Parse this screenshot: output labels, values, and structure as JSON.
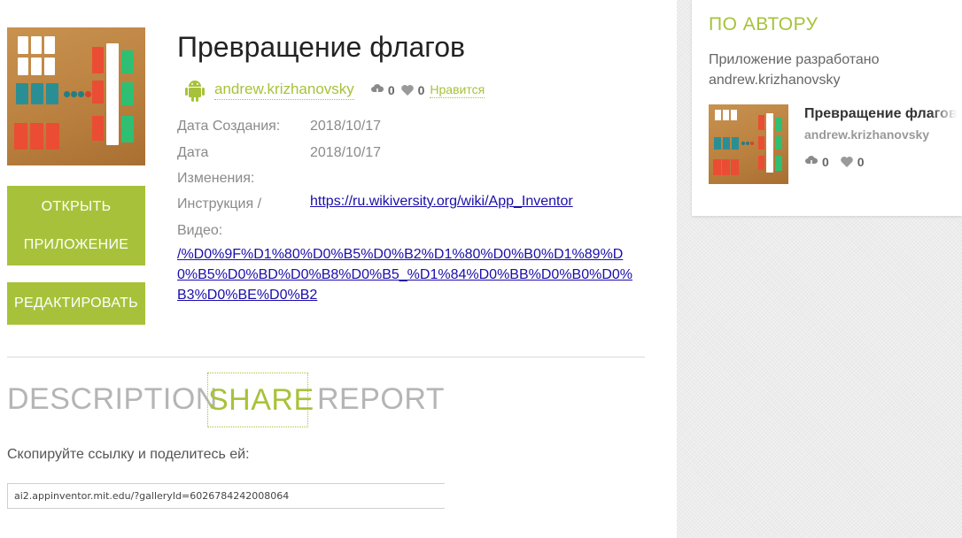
{
  "app": {
    "title": "Превращение флагов",
    "author": "andrew.krizhanovsky",
    "downloads": "0",
    "likes": "0",
    "like_label": "Нравится"
  },
  "buttons": {
    "open_line1": "ОТКРЫТЬ",
    "open_line2": "ПРИЛОЖЕНИЕ",
    "edit": "РЕДАКТИРОВАТЬ"
  },
  "meta": {
    "created_label": "Дата Создания:",
    "created_value": "2018/10/17",
    "changed_label_1": "Дата",
    "changed_value": "2018/10/17",
    "changed_label_2": "Изменения:",
    "instruction_label": "Инструкция /",
    "instruction_link": "https://ru.wikiversity.org/wiki/App_Inventor",
    "video_label": "Видео:",
    "video_link": "/%D0%9F%D1%80%D0%B5%D0%B2%D1%80%D0%B0%D1%89%D0%B5%D0%BD%D0%B8%D0%B5_%D1%84%D0%BB%D0%B0%D0%B3%D0%BE%D0%B2"
  },
  "tabs": {
    "description": "DESCRIPTION",
    "share": "SHARE",
    "report": "REPORT"
  },
  "share": {
    "label": "Скопируйте ссылку и поделитесь ей:",
    "url": "ai2.appinventor.mit.edu/?galleryId=6026784242008064"
  },
  "sidebar": {
    "title": "ПО АВТОРУ",
    "desc_line1": "Приложение разработано",
    "desc_line2": "andrew.krizhanovsky",
    "app_title": "Превращение флагов",
    "app_author": "andrew.krizhanovsky",
    "downloads": "0",
    "likes": "0"
  },
  "colors": {
    "accent": "#a7c23a",
    "link": "#1a0dab",
    "card_red": "#ea4d33",
    "card_teal": "#2a8f94",
    "card_green": "#2fbf72",
    "card_white": "#ffffff"
  },
  "icons": {
    "platform": "android-icon",
    "downloads": "cloud-download-icon",
    "likes": "heart-icon"
  }
}
